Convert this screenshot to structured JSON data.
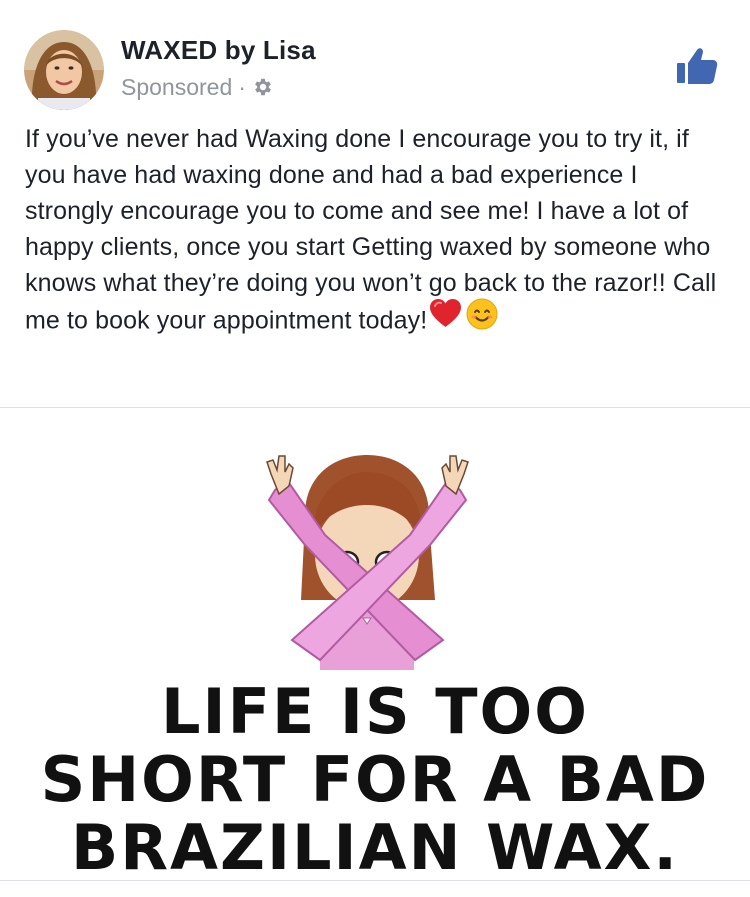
{
  "post": {
    "author": "WAXED by Lisa",
    "sponsored_label": "Sponsored",
    "separator": "·",
    "icons": {
      "settings": "gear-icon",
      "like": "thumbs-up-icon",
      "emojis": [
        "red-heart-emoji",
        "smiling-face-emoji"
      ]
    },
    "body_text": "If you’ve never had Waxing done I encourage you to try it, if you have had waxing done and had a bad experience I strongly encourage you to come and see me! I have a lot of happy clients, once you start Getting waxed by someone who knows what they’re doing you won’t go back to the razor!! Call me to book your appointment today!"
  },
  "image": {
    "meme_lines": [
      "LIFE IS TOO",
      "SHORT FOR A BAD",
      "BRAZILIAN WAX."
    ],
    "emoji": "no-gesture-woman-emoji"
  },
  "colors": {
    "like_blue": "#4267b2",
    "text": "#1d2129",
    "meta_gray": "#90949c",
    "divider": "#dddfe2"
  }
}
